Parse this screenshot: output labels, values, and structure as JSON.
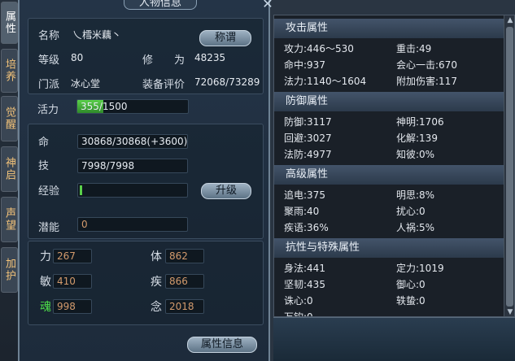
{
  "panel": {
    "title": "人物信息",
    "close_icon": "close-icon"
  },
  "side_tabs": [
    {
      "label": "属性",
      "active": true
    },
    {
      "label": "培养",
      "active": false
    },
    {
      "label": "觉醒",
      "active": false
    },
    {
      "label": "神启",
      "active": false
    },
    {
      "label": "声望",
      "active": false
    },
    {
      "label": "加护",
      "active": false
    }
  ],
  "info": {
    "name_label": "名称",
    "name_value": "乀樰米藕丶",
    "title_button": "称谓",
    "level_label": "等级",
    "level_value": "80",
    "cultivation_label": "修　　为",
    "cultivation_value": "48235",
    "faction_label": "门派",
    "faction_value": "冰心堂",
    "equip_label": "装备评价",
    "equip_value": "72068/73289"
  },
  "vitality": {
    "label": "活力",
    "value": "355/1500",
    "fraction": 0.2367
  },
  "bars": {
    "life_label": "命",
    "life_value": "30868/30868(+3600)",
    "skill_label": "技",
    "skill_value": "7998/7998",
    "exp_label": "经验",
    "upgrade_button": "升级",
    "potential_label": "潜能",
    "potential_value": "0"
  },
  "stats": [
    {
      "label": "力",
      "value": "267"
    },
    {
      "label": "体",
      "value": "862"
    },
    {
      "label": "敏",
      "value": "410"
    },
    {
      "label": "疾",
      "value": "866"
    },
    {
      "label": "魂",
      "value": "998"
    },
    {
      "label": "念",
      "value": "2018"
    }
  ],
  "attr_button": "属性信息",
  "attributes": {
    "sections": [
      {
        "title": "攻击属性",
        "rows": [
          [
            "攻力:446～530",
            "重击:49"
          ],
          [
            "命中:937",
            "会心一击:670"
          ],
          [
            "法力:1140～1604",
            "附加伤害:117"
          ]
        ]
      },
      {
        "title": "防御属性",
        "rows": [
          [
            "防御:3117",
            "神明:1706"
          ],
          [
            "回避:3027",
            "化解:139"
          ],
          [
            "法防:4977",
            "知彼:0%"
          ]
        ]
      },
      {
        "title": "高级属性",
        "rows": [
          [
            "追电:375",
            "明思:8%"
          ],
          [
            "聚雨:40",
            "扰心:0"
          ],
          [
            "疾语:36%",
            "人祸:5%"
          ]
        ]
      },
      {
        "title": "抗性与特殊属性",
        "rows": [
          [
            "身法:441",
            "定力:1019"
          ],
          [
            "坚韧:435",
            "御心:0"
          ],
          [
            "诛心:0",
            "轶蛰:0"
          ],
          [
            "万钧:0",
            ""
          ]
        ]
      }
    ]
  }
}
